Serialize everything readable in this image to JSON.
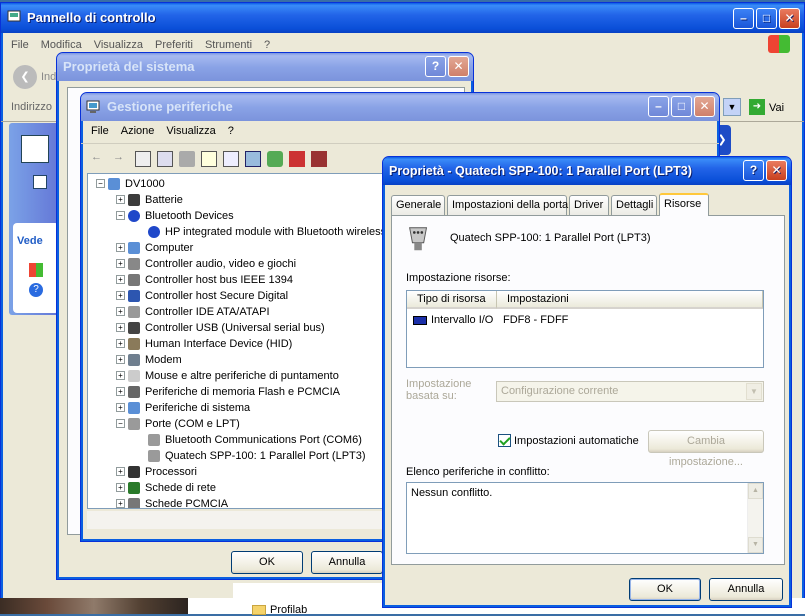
{
  "control_panel": {
    "title": "Pannello di controllo",
    "menu": [
      "File",
      "Modifica",
      "Visualizza",
      "Preferiti",
      "Strumenti",
      "?"
    ],
    "address_label": "Indirizzo",
    "address_prefix": "Ind",
    "go_label": "Vai",
    "side_title": "Vede",
    "taskbar_item": "Profilab"
  },
  "system_props": {
    "title": "Proprietà del sistema",
    "ok_label": "OK",
    "cancel_label": "Annulla"
  },
  "device_manager": {
    "title": "Gestione periferiche",
    "menu": [
      "File",
      "Azione",
      "Visualizza",
      "?"
    ],
    "tree": [
      {
        "label": "DV1000",
        "level": 0,
        "expander": "-",
        "icon": "computer-icon"
      },
      {
        "label": "Batterie",
        "level": 1,
        "expander": "+",
        "icon": "battery-icon"
      },
      {
        "label": "Bluetooth Devices",
        "level": 1,
        "expander": "-",
        "icon": "bluetooth-icon"
      },
      {
        "label": "HP integrated module with Bluetooth wireless",
        "level": 2,
        "expander": "",
        "icon": "bluetooth-icon"
      },
      {
        "label": "Computer",
        "level": 1,
        "expander": "+",
        "icon": "monitor-icon"
      },
      {
        "label": "Controller audio, video e giochi",
        "level": 1,
        "expander": "+",
        "icon": "audio-icon"
      },
      {
        "label": "Controller host bus IEEE 1394",
        "level": 1,
        "expander": "+",
        "icon": "firewire-icon"
      },
      {
        "label": "Controller host Secure Digital",
        "level": 1,
        "expander": "+",
        "icon": "sd-icon"
      },
      {
        "label": "Controller IDE ATA/ATAPI",
        "level": 1,
        "expander": "+",
        "icon": "ide-icon"
      },
      {
        "label": "Controller USB (Universal serial bus)",
        "level": 1,
        "expander": "+",
        "icon": "usb-icon"
      },
      {
        "label": "Human Interface Device (HID)",
        "level": 1,
        "expander": "+",
        "icon": "hid-icon"
      },
      {
        "label": "Modem",
        "level": 1,
        "expander": "+",
        "icon": "modem-icon"
      },
      {
        "label": "Mouse e altre periferiche di puntamento",
        "level": 1,
        "expander": "+",
        "icon": "mouse-icon"
      },
      {
        "label": "Periferiche di memoria Flash e PCMCIA",
        "level": 1,
        "expander": "+",
        "icon": "flash-icon"
      },
      {
        "label": "Periferiche di sistema",
        "level": 1,
        "expander": "+",
        "icon": "system-icon"
      },
      {
        "label": "Porte (COM e LPT)",
        "level": 1,
        "expander": "-",
        "icon": "port-icon"
      },
      {
        "label": "Bluetooth Communications Port (COM6)",
        "level": 2,
        "expander": "",
        "icon": "port-icon"
      },
      {
        "label": "Quatech SPP-100:  1 Parallel Port (LPT3)",
        "level": 2,
        "expander": "",
        "icon": "port-icon"
      },
      {
        "label": "Processori",
        "level": 1,
        "expander": "+",
        "icon": "cpu-icon"
      },
      {
        "label": "Schede di rete",
        "level": 1,
        "expander": "+",
        "icon": "network-icon"
      },
      {
        "label": "Schede PCMCIA",
        "level": 1,
        "expander": "+",
        "icon": "pcmcia-icon"
      }
    ]
  },
  "props_dialog": {
    "title": "Proprietà - Quatech SPP-100:  1 Parallel Port (LPT3)",
    "tabs": [
      "Generale",
      "Impostazioni della porta",
      "Driver",
      "Dettagli",
      "Risorse"
    ],
    "active_tab": "Risorse",
    "device_name": "Quatech SPP-100:  1 Parallel Port (LPT3)",
    "resource_settings_label": "Impostazione risorse:",
    "col_type": "Tipo di risorsa",
    "col_settings": "Impostazioni",
    "rows": [
      {
        "type": "Intervallo I/O",
        "setting": "FDF8 - FDFF"
      }
    ],
    "setting_based_on_line1": "Impostazione",
    "setting_based_on_line2": "basata su:",
    "setting_based_on_value": "Configurazione corrente",
    "auto_settings_label": "Impostazioni automatiche",
    "auto_settings_checked": true,
    "change_settings_label": "Cambia impostazione...",
    "conflict_label": "Elenco periferiche in conflitto:",
    "conflict_value": "Nessun conflitto.",
    "ok_label": "OK",
    "cancel_label": "Annulla"
  }
}
